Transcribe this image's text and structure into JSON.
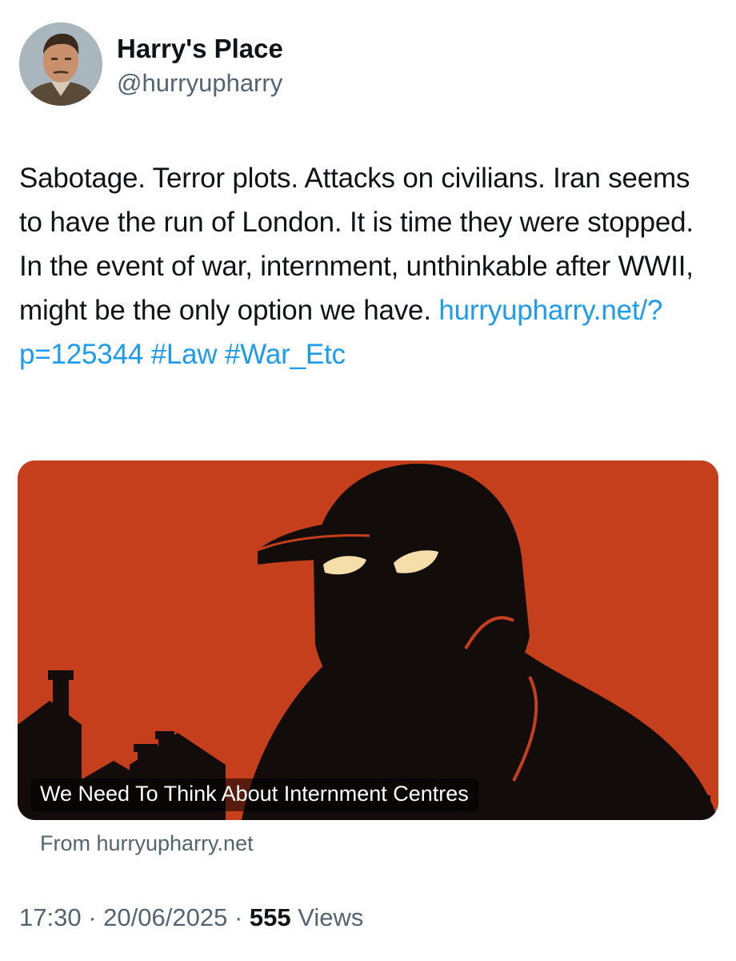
{
  "author": {
    "display_name": "Harry's Place",
    "handle": "@hurryupharry",
    "avatar_icon": "profile-photo"
  },
  "tweet": {
    "text": "Sabotage. Terror plots. Attacks on civilians. Iran seems to have the run of London. It is time they were stopped. In the event of war, internment, unthinkable after WWII, might be the only option we have.",
    "link": "hurryupharry.net/?p=125344",
    "hashtags": [
      "#Law",
      "#War_Etc"
    ]
  },
  "card": {
    "title": "We Need To Think About Internment Centres",
    "source": "From hurryupharry.net",
    "image_icon": "hooded-figure-illustration"
  },
  "meta": {
    "time": "17:30",
    "separator": "·",
    "date": "20/06/2025",
    "views_count": "555",
    "views_label": "Views"
  },
  "colors": {
    "link": "#1d9bf0",
    "card_background": "#c63f1c",
    "secondary_text": "#536471",
    "primary_text": "#0f1419"
  }
}
